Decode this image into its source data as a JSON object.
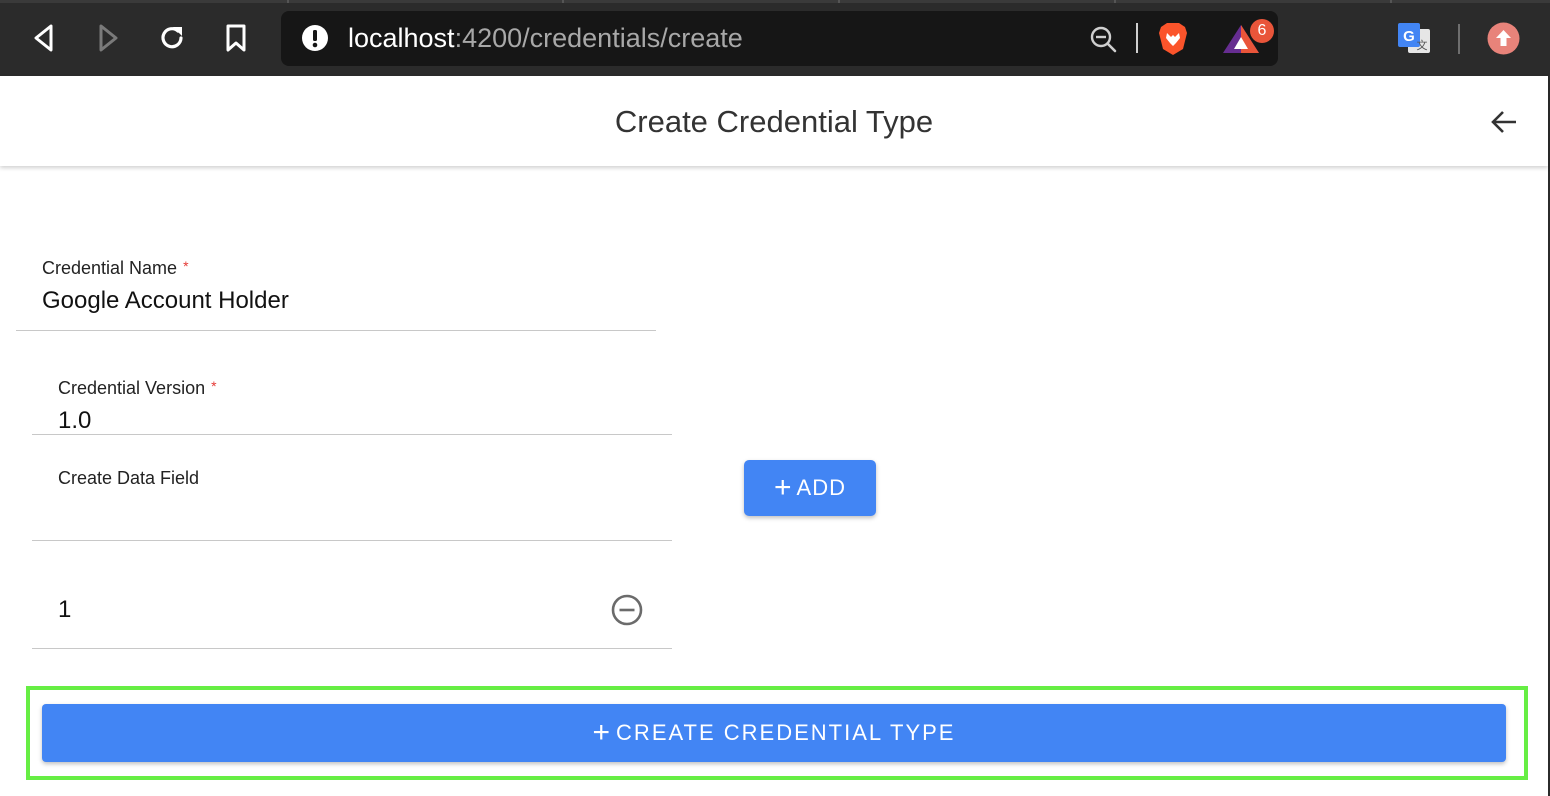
{
  "browser": {
    "url_host": "localhost",
    "url_path": ":4200/credentials/create",
    "rewards_badge": "6",
    "colors": {
      "chrome_bg": "#2b2b2b",
      "urlbar_bg": "#161616",
      "brave_orange": "#fb542b",
      "badge": "#e9553a"
    },
    "icons": [
      "back-icon",
      "forward-icon",
      "reload-icon",
      "bookmark-icon",
      "site-info-icon",
      "zoom-out-icon",
      "brave-shields-icon",
      "brave-rewards-icon",
      "translate-icon",
      "update-icon"
    ]
  },
  "header": {
    "title": "Create Credential Type",
    "back_icon": "arrow-back-icon"
  },
  "form": {
    "credential_name": {
      "label": "Credential Name",
      "required_mark": "*",
      "value": "Google Account Holder"
    },
    "credential_version": {
      "label": "Credential Version",
      "required_mark": "*",
      "value": "1.0"
    },
    "data_field": {
      "label": "Create Data Field",
      "value": ""
    },
    "add_button": {
      "icon": "+",
      "label": "ADD"
    },
    "fields_list": [
      {
        "value": "1",
        "remove_icon": "remove-circle-icon"
      }
    ],
    "create_button": {
      "icon": "+",
      "label": "CREATE CREDENTIAL TYPE"
    }
  },
  "colors": {
    "primary": "#4285f4",
    "highlight": "#66ee44",
    "required": "#e53935"
  }
}
